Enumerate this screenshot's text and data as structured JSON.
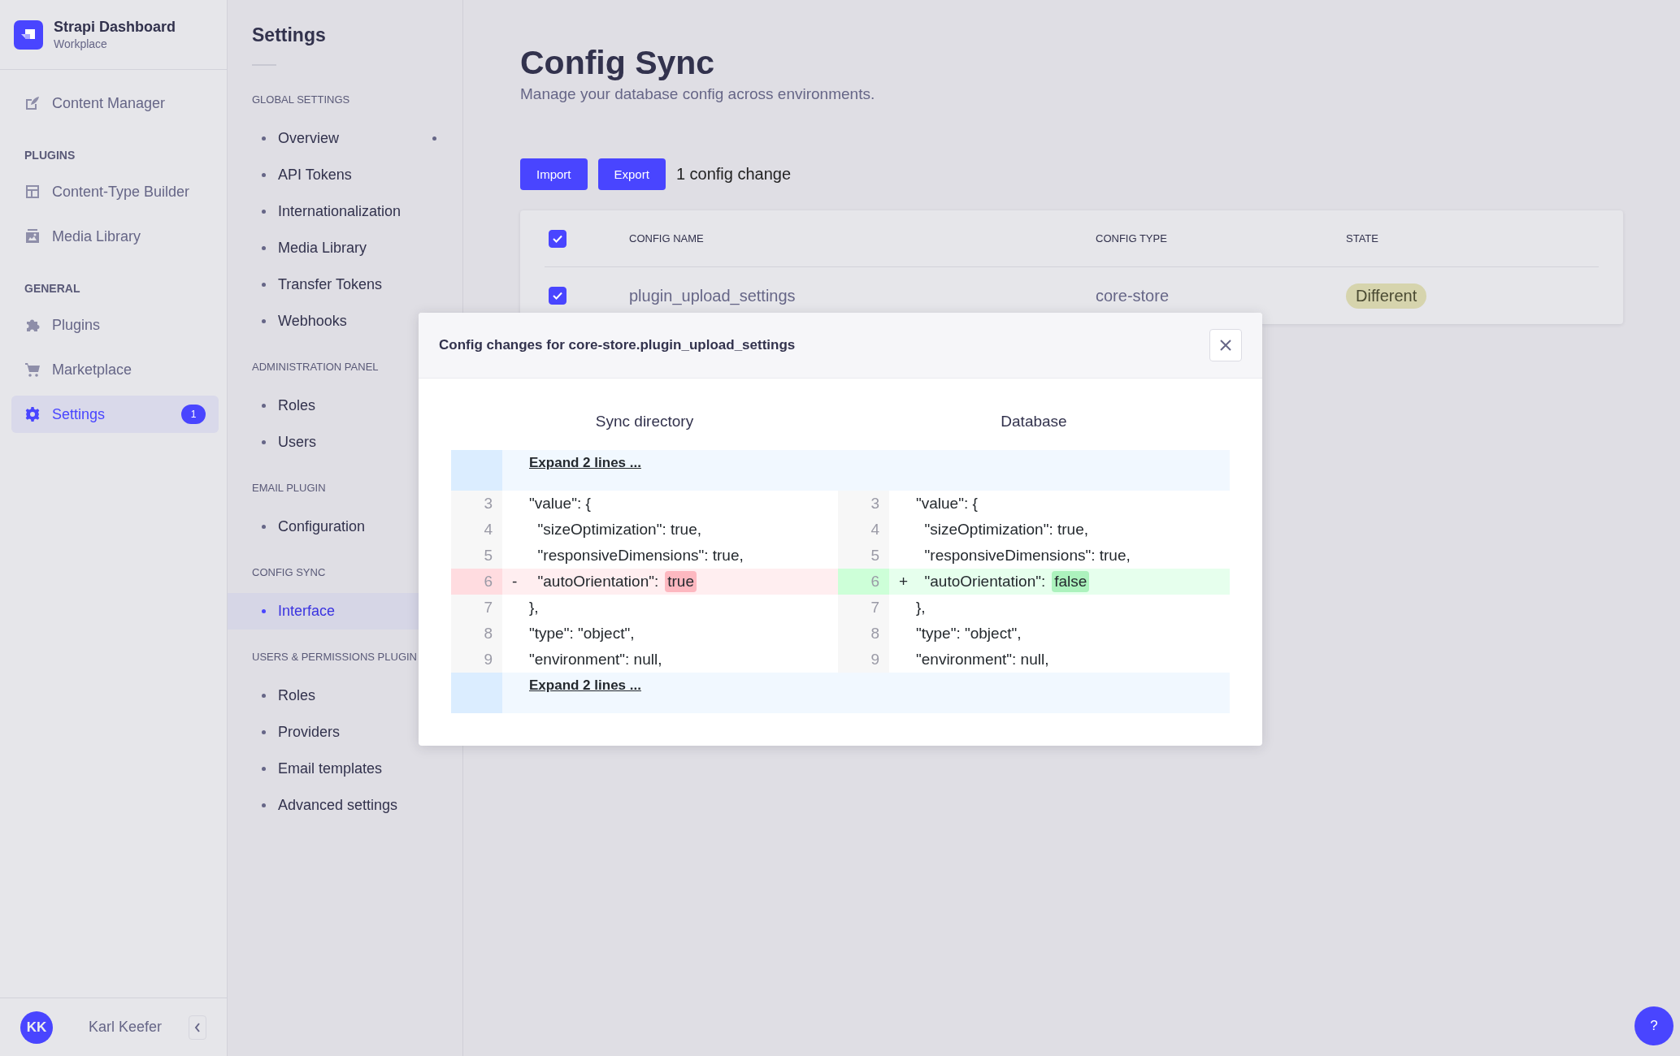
{
  "brand": {
    "title": "Strapi Dashboard",
    "subtitle": "Workplace"
  },
  "nav": [
    {
      "kind": "item",
      "label": "Content Manager",
      "selected": false
    },
    {
      "kind": "section",
      "label": "PLUGINS"
    },
    {
      "kind": "item",
      "label": "Content-Type Builder",
      "selected": false
    },
    {
      "kind": "item",
      "label": "Media Library",
      "selected": false
    },
    {
      "kind": "section",
      "label": "GENERAL"
    },
    {
      "kind": "item",
      "label": "Plugins",
      "selected": false
    },
    {
      "kind": "item",
      "label": "Marketplace",
      "selected": false
    },
    {
      "kind": "item",
      "label": "Settings",
      "selected": true,
      "badge": "1"
    }
  ],
  "user": {
    "initials": "KK",
    "name": "Karl Keefer"
  },
  "settings_nav": {
    "title": "Settings",
    "sections": [
      {
        "title": "GLOBAL SETTINGS",
        "items": [
          {
            "label": "Overview",
            "selected": false,
            "dot": true
          },
          {
            "label": "API Tokens",
            "selected": false
          },
          {
            "label": "Internationalization",
            "selected": false
          },
          {
            "label": "Media Library",
            "selected": false
          },
          {
            "label": "Transfer Tokens",
            "selected": false
          },
          {
            "label": "Webhooks",
            "selected": false
          }
        ]
      },
      {
        "title": "ADMINISTRATION PANEL",
        "items": [
          {
            "label": "Roles",
            "selected": false
          },
          {
            "label": "Users",
            "selected": false
          }
        ]
      },
      {
        "title": "EMAIL PLUGIN",
        "items": [
          {
            "label": "Configuration",
            "selected": false
          }
        ]
      },
      {
        "title": "CONFIG SYNC",
        "items": [
          {
            "label": "Interface",
            "selected": true
          }
        ]
      },
      {
        "title": "USERS & PERMISSIONS PLUGIN",
        "items": [
          {
            "label": "Roles",
            "selected": false
          },
          {
            "label": "Providers",
            "selected": false
          },
          {
            "label": "Email templates",
            "selected": false
          },
          {
            "label": "Advanced settings",
            "selected": false
          }
        ]
      }
    ]
  },
  "page": {
    "title": "Config Sync",
    "subtitle": "Manage your database config across environments.",
    "buttons": [
      "Import",
      "Export"
    ],
    "change_count": "1 config change"
  },
  "table": {
    "header_checked": true,
    "columns": [
      "CONFIG NAME",
      "CONFIG TYPE",
      "STATE"
    ],
    "rows": [
      {
        "checked": true,
        "name": "plugin_upload_settings",
        "type": "core-store",
        "state": "Different"
      }
    ]
  },
  "modal": {
    "title": "Config changes for core-store.plugin_upload_settings",
    "headings": [
      "Sync directory",
      "Database"
    ],
    "blocks": [
      {
        "kind": "expand",
        "label": "Expand 2 lines ..."
      },
      {
        "kind": "lines",
        "rows": [
          {
            "left": {
              "number": "3",
              "kind": "same",
              "text": "\"value\": {"
            },
            "right": {
              "number": "3",
              "kind": "same",
              "text": "\"value\": {"
            }
          },
          {
            "left": {
              "number": "4",
              "kind": "same",
              "text": "  \"sizeOptimization\": true,"
            },
            "right": {
              "number": "4",
              "kind": "same",
              "text": "  \"sizeOptimization\": true,"
            }
          },
          {
            "left": {
              "number": "5",
              "kind": "same",
              "text": "  \"responsiveDimensions\": true,"
            },
            "right": {
              "number": "5",
              "kind": "same",
              "text": "  \"responsiveDimensions\": true,"
            }
          },
          {
            "left": {
              "number": "6",
              "kind": "removed",
              "marker": "-",
              "text": "  \"autoOrientation\":",
              "highlight": "true"
            },
            "right": {
              "number": "6",
              "kind": "added",
              "marker": "+",
              "text": "  \"autoOrientation\":",
              "highlight": "false"
            }
          },
          {
            "left": {
              "number": "7",
              "kind": "same",
              "text": "},"
            },
            "right": {
              "number": "7",
              "kind": "same",
              "text": "},"
            }
          },
          {
            "left": {
              "number": "8",
              "kind": "same",
              "text": "\"type\": \"object\","
            },
            "right": {
              "number": "8",
              "kind": "same",
              "text": "\"type\": \"object\","
            }
          },
          {
            "left": {
              "number": "9",
              "kind": "same",
              "text": "\"environment\": null,"
            },
            "right": {
              "number": "9",
              "kind": "same",
              "text": "\"environment\": null,"
            }
          }
        ]
      },
      {
        "kind": "expand",
        "label": "Expand 2 lines ..."
      }
    ]
  },
  "help": {
    "label": "?"
  }
}
